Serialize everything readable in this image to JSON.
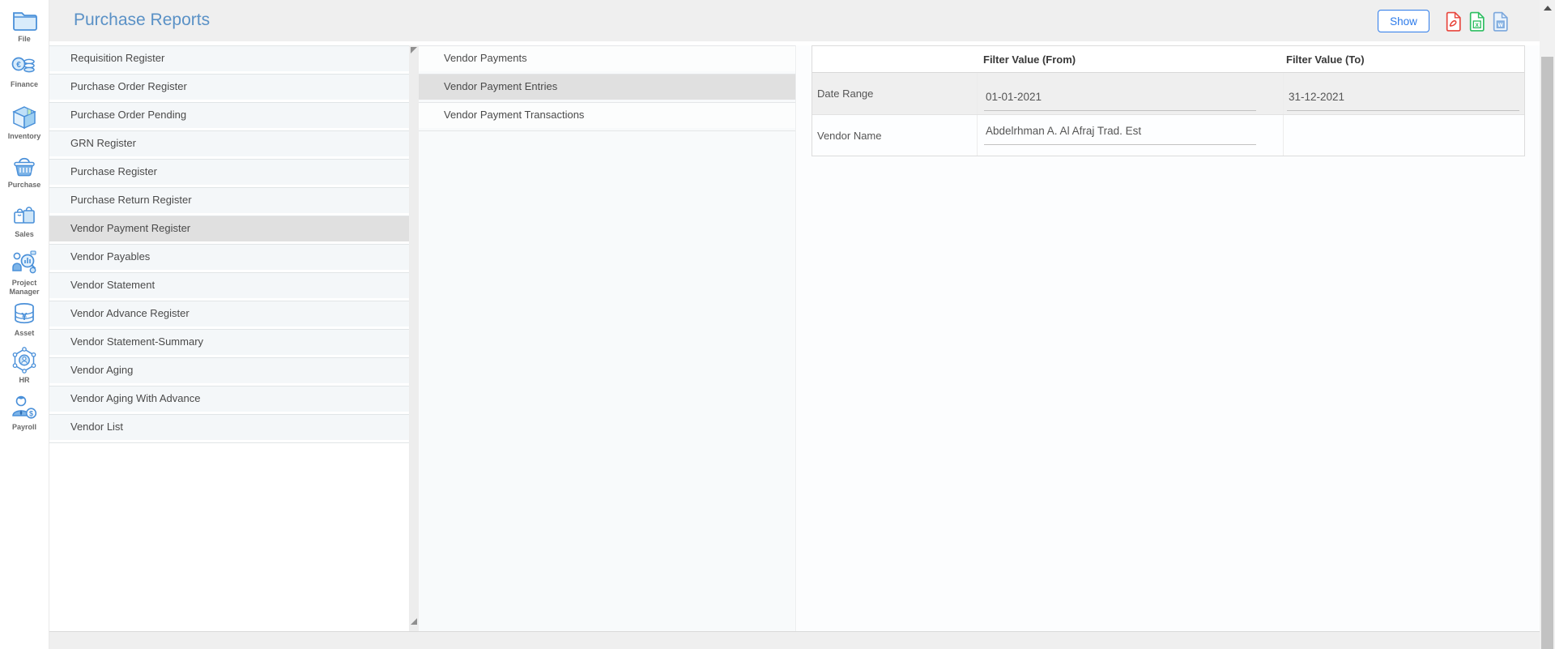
{
  "app": {
    "title": "Purchase Reports"
  },
  "sidebar": {
    "modules": [
      {
        "label": "File"
      },
      {
        "label": "Finance"
      },
      {
        "label": "Inventory"
      },
      {
        "label": "Purchase"
      },
      {
        "label": "Sales"
      },
      {
        "label": "Project Manager"
      },
      {
        "label": "Asset"
      },
      {
        "label": "HR"
      },
      {
        "label": "Payroll"
      }
    ]
  },
  "toolbar": {
    "show_label": "Show",
    "export_icons": [
      {
        "name": "export-pdf",
        "color": "#e8453c"
      },
      {
        "name": "export-excel",
        "color": "#2dbe60"
      },
      {
        "name": "export-word",
        "color": "#7ba7dc"
      }
    ]
  },
  "report_list": {
    "selected": "Vendor Payment Register",
    "selected_index": 6,
    "items": [
      "Requisition Register",
      "Purchase Order Register",
      "Purchase Order Pending",
      "GRN Register",
      "Purchase Register",
      "Purchase Return Register",
      "Vendor Payment Register",
      "Vendor Payables",
      "Vendor Statement",
      "Vendor Advance Register",
      "Vendor Statement-Summary",
      "Vendor Aging",
      "Vendor Aging With Advance",
      "Vendor List"
    ]
  },
  "sub_report_list": {
    "selected": "Vendor Payment Entries",
    "selected_index": 1,
    "items": [
      "Vendor Payments",
      "Vendor Payment Entries",
      "Vendor Payment Transactions"
    ]
  },
  "filter_table": {
    "columns": {
      "from": "Filter Value (From)",
      "to": "Filter Value (To)"
    },
    "rows": [
      {
        "label": "Date Range",
        "from": "01-01-2021",
        "to": "31-12-2021"
      },
      {
        "label": "Vendor Name",
        "from": "Abdelrhman A. Al Afraj Trad. Est",
        "to": ""
      }
    ]
  },
  "colors": {
    "title_blue": "#5a91c6",
    "accent_blue": "#2d7bea",
    "icon_blue": "#4a90d9",
    "selected_gray": "#e0e0e0",
    "header_gray": "#efefef"
  }
}
